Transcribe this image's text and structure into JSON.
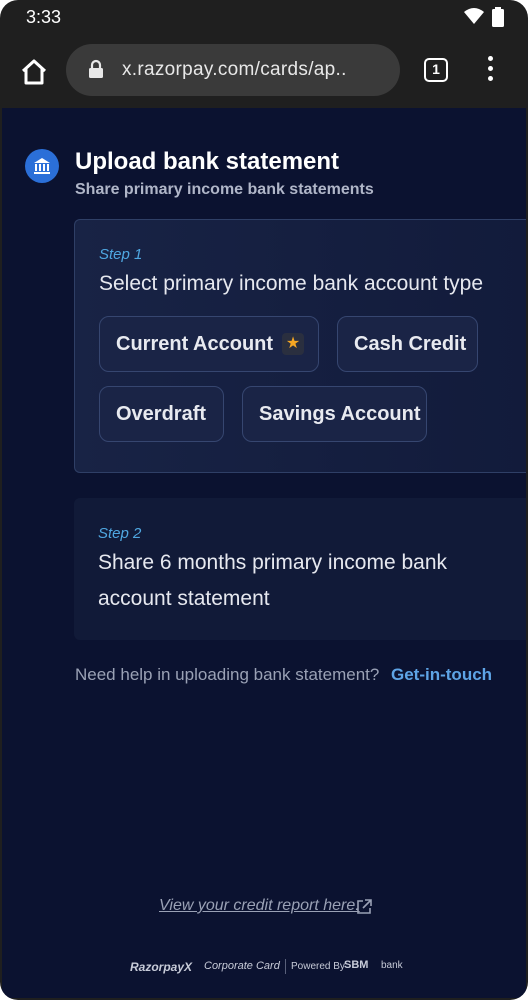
{
  "status_bar": {
    "time": "3:33",
    "icons": [
      "wifi-icon",
      "battery-icon"
    ]
  },
  "browser": {
    "url": "x.razorpay.com/cards/ap..",
    "tab_count": "1",
    "icons": [
      "home-icon",
      "lock-icon",
      "tabs-icon",
      "more-vert-icon"
    ]
  },
  "header": {
    "icon": "bank-icon",
    "title": "Upload bank statement",
    "subtitle": "Share primary income bank statements"
  },
  "step1": {
    "label": "Step 1",
    "text": "Select primary income bank account type",
    "options": [
      {
        "label": "Current Account",
        "recommended": true
      },
      {
        "label": "Cash Credit"
      },
      {
        "label": "Overdraft"
      },
      {
        "label": "Savings Account"
      }
    ],
    "star_glyph": "★"
  },
  "step2": {
    "label": "Step 2",
    "text_line1": "Share 6 months primary income bank",
    "text_line2": "account statement"
  },
  "help": {
    "text": "Need help in uploading bank statement?",
    "link": "Get-in-touch"
  },
  "credit_report": {
    "text": "View your credit report here.",
    "icon": "external-link-icon"
  },
  "footer": {
    "brand": "RazorpayX",
    "product": "Corporate Card",
    "powered_by": "Powered By",
    "partner": "SBM",
    "partner_suffix": "bank"
  },
  "colors": {
    "page_bg": "#0b1230",
    "accent_link": "#5ea4e6",
    "step_label": "#4fa6e0",
    "star": "#f5a623"
  }
}
